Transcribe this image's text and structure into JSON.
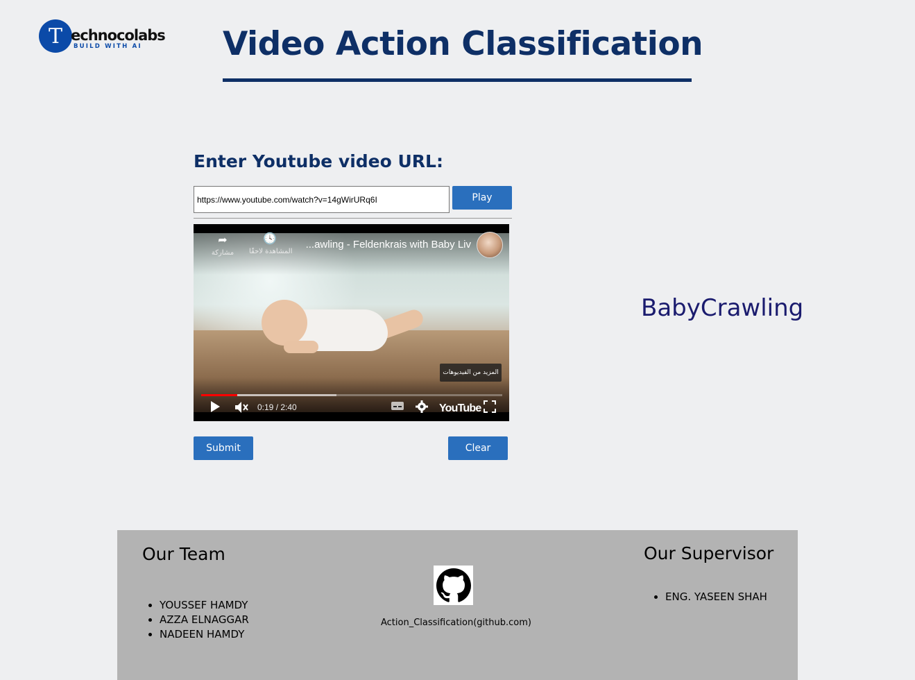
{
  "header": {
    "logo_letter": "T",
    "logo_word": "echnocolabs",
    "logo_tagline": "BUILD WITH AI",
    "title": "Video Action Classification"
  },
  "form": {
    "url_label": "Enter Youtube video URL:",
    "url_value": "https://www.youtube.com/watch?v=14gWirURq6I",
    "play_label": "Play",
    "submit_label": "Submit",
    "clear_label": "Clear"
  },
  "video": {
    "title": "...awling - Feldenkrais with Baby Liv",
    "share_label": "مشاركة",
    "watch_later_label": "المشاهدة لاحقًا",
    "more_videos_label": "المزيد من الفيديوهات",
    "time": "0:19 / 2:40",
    "progress": 0.12,
    "buffered": 0.45,
    "platform_logo": "YouTube",
    "icons": [
      "share-icon",
      "clock-icon",
      "play-icon",
      "mute-icon",
      "captions-icon",
      "settings-icon",
      "fullscreen-icon"
    ]
  },
  "result": {
    "prediction": "BabyCrawling"
  },
  "footer": {
    "team_title": "Our Team",
    "team_members": [
      "YOUSSEF HAMDY",
      "AZZA ELNAGGAR",
      "NADEEN HAMDY"
    ],
    "github_link": "Action_Classification(github.com)",
    "supervisor_title": "Our Supervisor",
    "supervisors": [
      "ENG. YASEEN SHAH"
    ]
  },
  "colors": {
    "page_bg": "#eeeff1",
    "title": "#0e2f66",
    "button": "#2a6fbd",
    "prediction": "#1a1b6e",
    "footer_bg": "#b3b3b3",
    "progress": "#ff0000"
  }
}
